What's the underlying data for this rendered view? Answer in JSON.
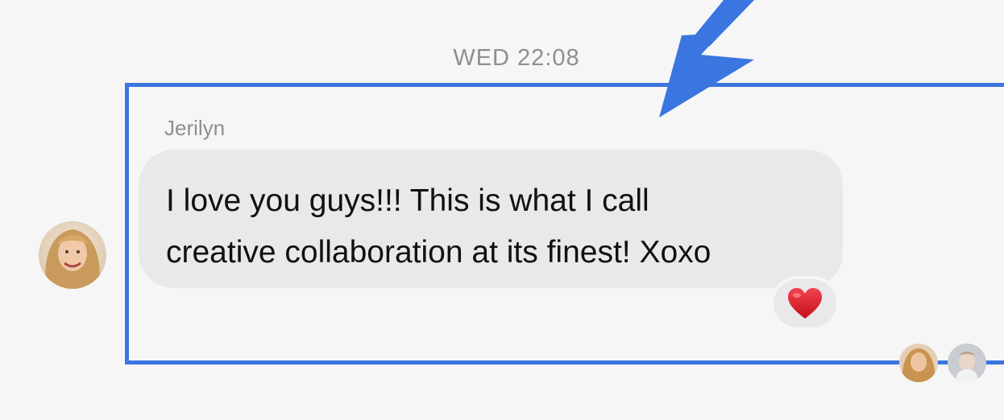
{
  "conversation": {
    "timestamp": "WED 22:08",
    "message": {
      "sender": "Jerilyn",
      "lines": [
        "I love you guys!!! This is what I call",
        "creative collaboration at its finest! Xoxo"
      ],
      "reaction": "heart-emoji"
    },
    "read_receipts": [
      "avatar-1",
      "avatar-2"
    ]
  },
  "annotation": {
    "highlight_color": "#3a75e0",
    "arrow_color": "#3a75e0"
  },
  "colors": {
    "background": "#f6f6f6",
    "bubble": "#e9e9eb",
    "meta_text": "#8e8e93",
    "heart": "#e0202e"
  }
}
